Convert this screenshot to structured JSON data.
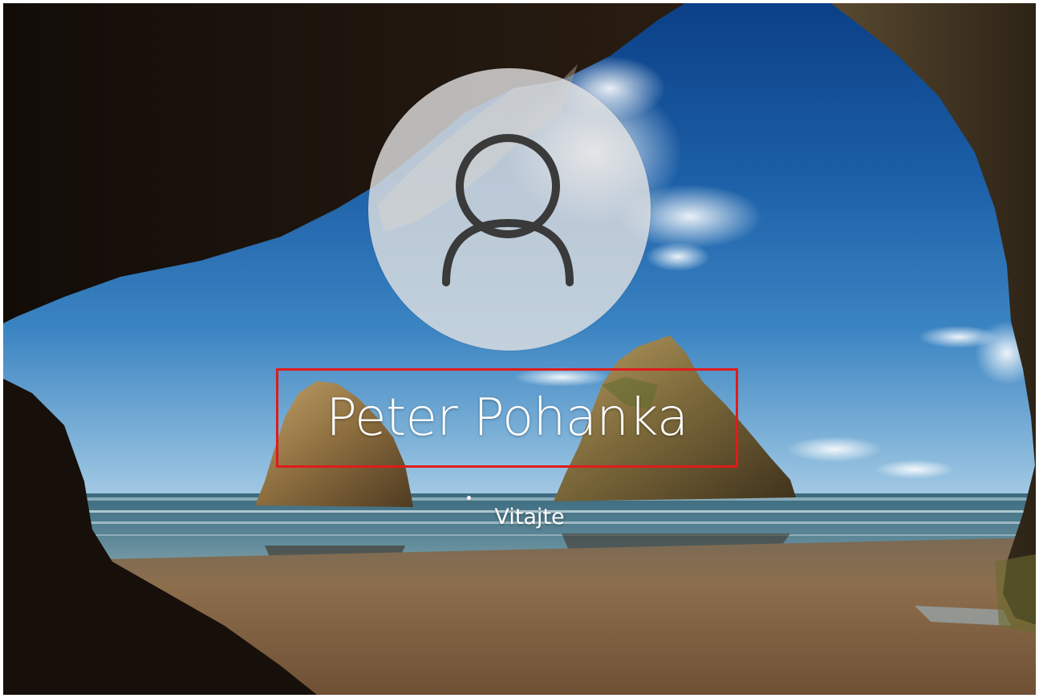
{
  "lock_screen": {
    "user_name": "Peter Pohanka",
    "status_text": "Vitajte",
    "avatar_icon": "user-icon",
    "highlight_color": "#e01b1b"
  }
}
